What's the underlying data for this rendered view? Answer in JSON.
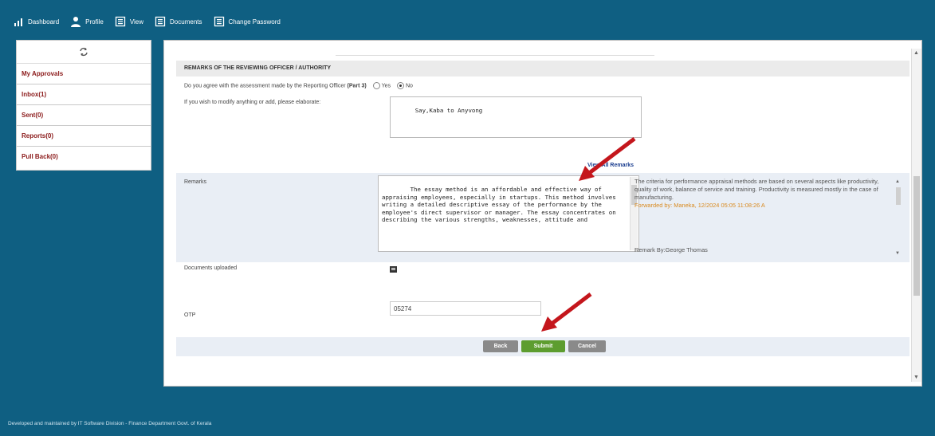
{
  "nav": {
    "items": [
      {
        "label": "Dashboard",
        "icon": "bar-chart-icon"
      },
      {
        "label": "Profile",
        "icon": "user-icon"
      },
      {
        "label": "View",
        "icon": "document-icon"
      },
      {
        "label": "Documents",
        "icon": "document-icon"
      },
      {
        "label": "Change Password",
        "icon": "document-icon"
      }
    ]
  },
  "sidebar": {
    "toggle_icon": "refresh-icon",
    "items": [
      {
        "label": "My Approvals"
      },
      {
        "label": "Inbox(1)"
      },
      {
        "label": "Sent(0)"
      },
      {
        "label": "Reports(0)"
      },
      {
        "label": "Pull Back(0)"
      }
    ]
  },
  "form": {
    "section_title": "REMARKS OF THE REVIEWING OFFICER / AUTHORITY",
    "agree_question": "Do you agree with the assessment made by the Reporting Officer",
    "agree_part": "(Part 3)",
    "option_yes": "Yes",
    "option_no": "No",
    "selected": "No",
    "modify_label": "If you wish to modify anything or add, please elaborate:",
    "modify_value": "Say,Kaba to Anyvong",
    "view_remarks_link": "View All Remarks",
    "remarks_label": "Remarks",
    "remarks_value": "The essay method is an affordable and effective way of appraising employees, especially in startups. This method involves writing a detailed descriptive essay of the performance by the employee's direct supervisor or manager. The essay concentrates on describing the various strengths, weaknesses, attitude and",
    "prev_remark_text": "The criteria for performance appraisal methods are based on several aspects like productivity, quality of work, balance of service and training. Productivity is measured mostly in the case of manufacturing.",
    "prev_remark_forwarded": "Forwarded by: Maneka, 12/2024 05:05 11:08:26 A",
    "prev_remark_by": "Remark By:George Thomas",
    "documents_label": "Documents uploaded",
    "documents_icon": "document-icon",
    "otp_label": "OTP",
    "otp_value": "05274",
    "buttons": {
      "back": "Back",
      "submit": "Submit",
      "cancel": "Cancel"
    }
  },
  "footer": {
    "text": "Developed and maintained by IT Software Division - Finance Department Govt. of Kerala"
  },
  "colors": {
    "header_bg": "#0f5f82",
    "submit_green": "#5d9d2f",
    "sidebar_text": "#8b1a1a",
    "annotation_red": "#c4161c"
  }
}
